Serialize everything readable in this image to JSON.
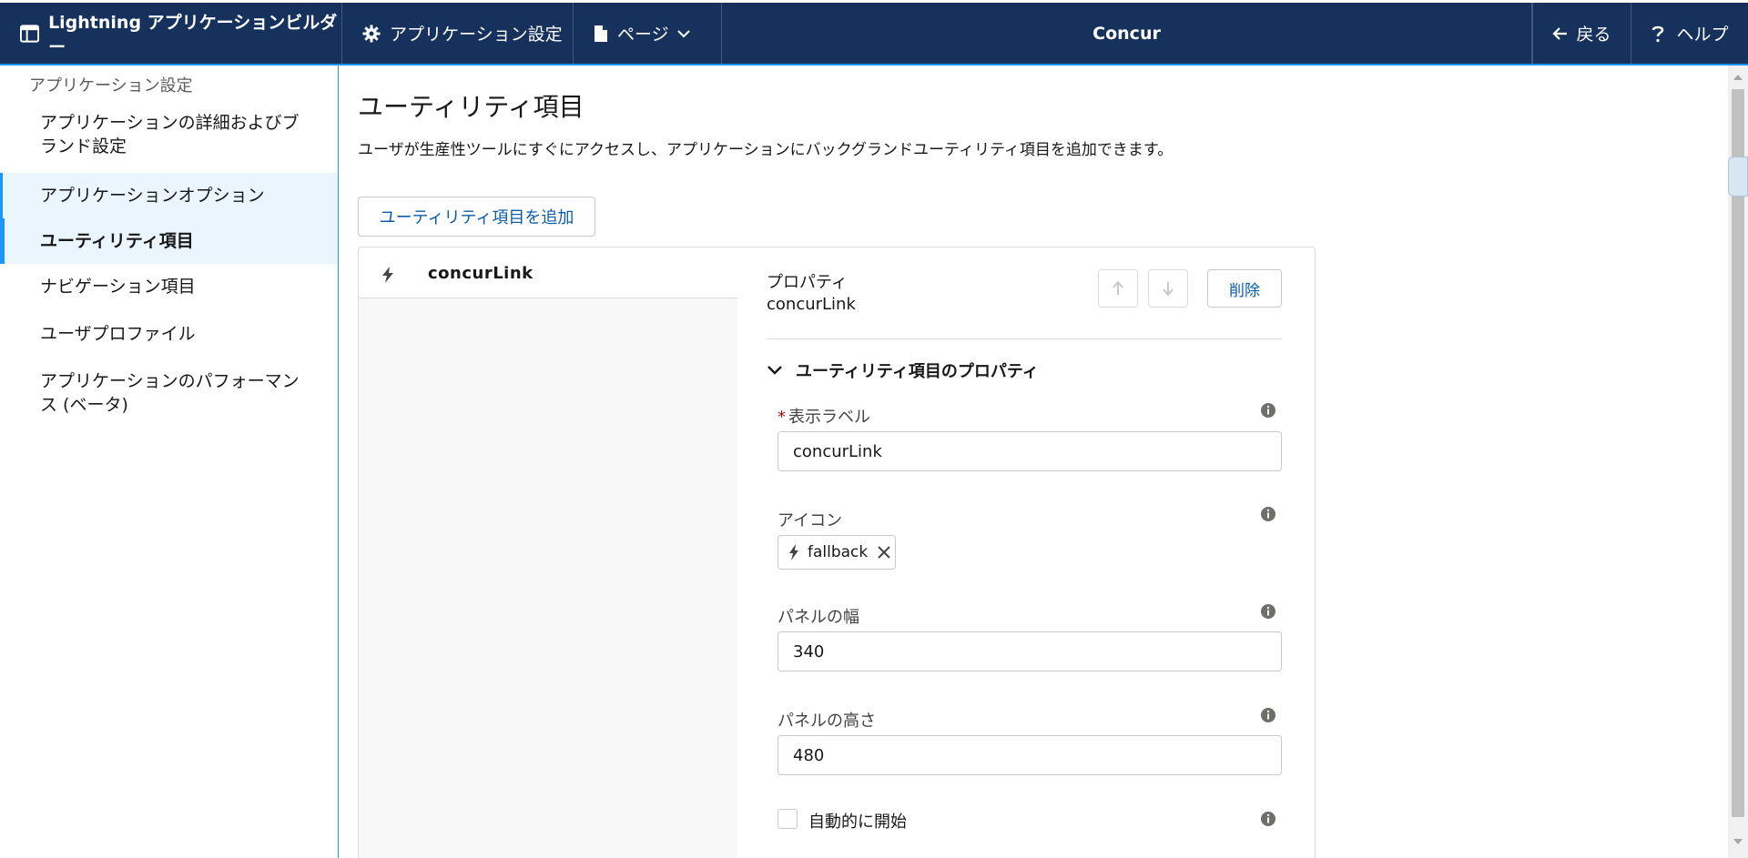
{
  "topbar": {
    "brand": "Lightning アプリケーションビルダー",
    "settings": "アプリケーション設定",
    "page": "ページ",
    "title": "Concur",
    "back": "戻る",
    "help": "ヘルプ"
  },
  "sidebar": {
    "heading": "アプリケーション設定",
    "items": [
      {
        "label": "アプリケーションの詳細およびブランド設定"
      },
      {
        "label": "アプリケーションオプション"
      },
      {
        "label": "ユーティリティ項目"
      },
      {
        "label": "ナビゲーション項目"
      },
      {
        "label": "ユーザプロファイル"
      },
      {
        "label": "アプリケーションのパフォーマンス (ベータ)"
      }
    ]
  },
  "main": {
    "title": "ユーティリティ項目",
    "description": "ユーザが生産性ツールにすぐにアクセスし、アプリケーションにバックグランドユーティリティ項目を追加できます。",
    "add_button": "ユーティリティ項目を追加",
    "list": [
      {
        "label": "concurLink",
        "icon": "bolt-icon"
      }
    ],
    "properties": {
      "kicker": "プロパティ",
      "name": "concurLink",
      "delete_label": "削除",
      "section_title": "ユーティリティ項目のプロパティ",
      "required_mark": "*",
      "fields": {
        "label": {
          "label": "表示ラベル",
          "value": "concurLink"
        },
        "icon": {
          "label": "アイコン",
          "value": "fallback"
        },
        "panel_width": {
          "label": "パネルの幅",
          "value": "340"
        },
        "panel_height": {
          "label": "パネルの高さ",
          "value": "480"
        },
        "autostart": {
          "label": "自動的に開始",
          "checked": false
        }
      }
    }
  },
  "colors": {
    "topbar_bg": "#16325c",
    "accent": "#1b96ff",
    "link": "#0b5cab",
    "highlight_bg": "#eaf5fe",
    "required": "#ba0517"
  }
}
